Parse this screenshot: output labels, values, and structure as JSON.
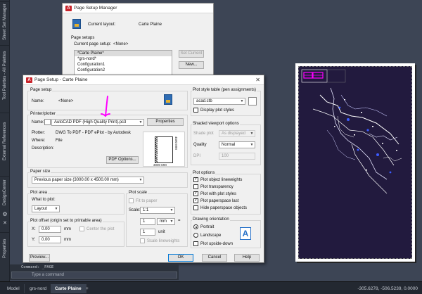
{
  "side_panel": {
    "tabs": [
      "Sheet Set Manager",
      "Tool Palettes - All Palettes",
      "External References",
      "DesignCenter",
      "Properties"
    ]
  },
  "page_setup_manager": {
    "title": "Page Setup Manager",
    "current_layout_label": "Current layout:",
    "current_layout_value": "Carte Plaine",
    "page_setups_label": "Page setups",
    "current_page_setup_label": "Current page setup:",
    "current_page_setup_value": "<None>",
    "list": [
      "*Carte Plaine*",
      "*grs-nord*",
      "Configuration1",
      "Configuration2"
    ],
    "buttons": {
      "set_current": "Set Current",
      "new": "New..."
    }
  },
  "page_setup": {
    "title": "Page Setup - Carte Plaine",
    "page_setup_group": "Page setup",
    "name_label": "Name:",
    "name_value": "<None>",
    "printer_group": "Printer/plotter",
    "printer_name_label": "Name:",
    "printer_name_value": "AutoCAD PDF (High Quality Print).pc3",
    "properties_button": "Properties",
    "plotter_label": "Plotter:",
    "plotter_value": "DWG To PDF - PDF ePlot - by Autodesk",
    "where_label": "Where:",
    "where_value": "File",
    "description_label": "Description:",
    "pdf_options_button": "PDF Options...",
    "preview_dim_h": "3000 MM",
    "preview_dim_v": "4500 MM",
    "paper_size_group": "Paper size",
    "paper_size_value": "Previous paper size (3000.00 x 4500.00 mm)",
    "plot_area_group": "Plot area",
    "what_to_plot_label": "What to plot:",
    "what_to_plot_value": "Layout",
    "plot_offset_group": "Plot offset (origin set to printable area)",
    "x_label": "X:",
    "x_value": "0.00",
    "y_label": "Y:",
    "y_value": "0.00",
    "offset_unit": "mm",
    "center_plot": "Center the plot",
    "plot_scale_group": "Plot scale",
    "fit_to_paper": "Fit to paper",
    "scale_label": "Scale:",
    "scale_value": "1:1",
    "scale_num": "1",
    "scale_unit_value": "mm",
    "scale_den": "1",
    "scale_den_unit": "unit",
    "scale_lineweights": "Scale lineweights",
    "pst_group": "Plot style table (pen assignments)",
    "pst_value": "acad.ctb",
    "display_plot_styles": "Display plot styles",
    "shaded_group": "Shaded viewport options",
    "shade_plot_label": "Shade plot",
    "shade_plot_value": "As displayed",
    "quality_label": "Quality",
    "quality_value": "Normal",
    "dpi_label": "DPI",
    "dpi_value": "100",
    "plot_options_group": "Plot options",
    "plot_options": [
      {
        "label": "Plot object lineweights",
        "checked": true
      },
      {
        "label": "Plot transparency",
        "checked": false
      },
      {
        "label": "Plot with plot styles",
        "checked": true
      },
      {
        "label": "Plot paperspace last",
        "checked": true
      },
      {
        "label": "Hide paperspace objects",
        "checked": false
      }
    ],
    "orientation_group": "Drawing orientation",
    "portrait": "Portrait",
    "landscape": "Landscape",
    "upside_down": "Plot upside-down",
    "orientation_selected": "Portrait",
    "buttons": {
      "preview": "Preview...",
      "ok": "OK",
      "cancel": "Cancel",
      "help": "Help"
    }
  },
  "command_line": {
    "history": "Command: _PAGE",
    "placeholder": "Type a command"
  },
  "status_bar": {
    "tabs": [
      "Model",
      "grs-nord",
      "Carte Plaine"
    ],
    "active_tab": "Carte Plaine",
    "add_tab": "+",
    "coords": "-305.6278, -506.5239, 0.0000",
    "paper_label": "PAPER"
  },
  "colors": {
    "workspace": "#3d4555",
    "plot_background": "#221a3e",
    "annotation_magenta": "#ff00ff",
    "accent_blue": "#0078d7"
  }
}
